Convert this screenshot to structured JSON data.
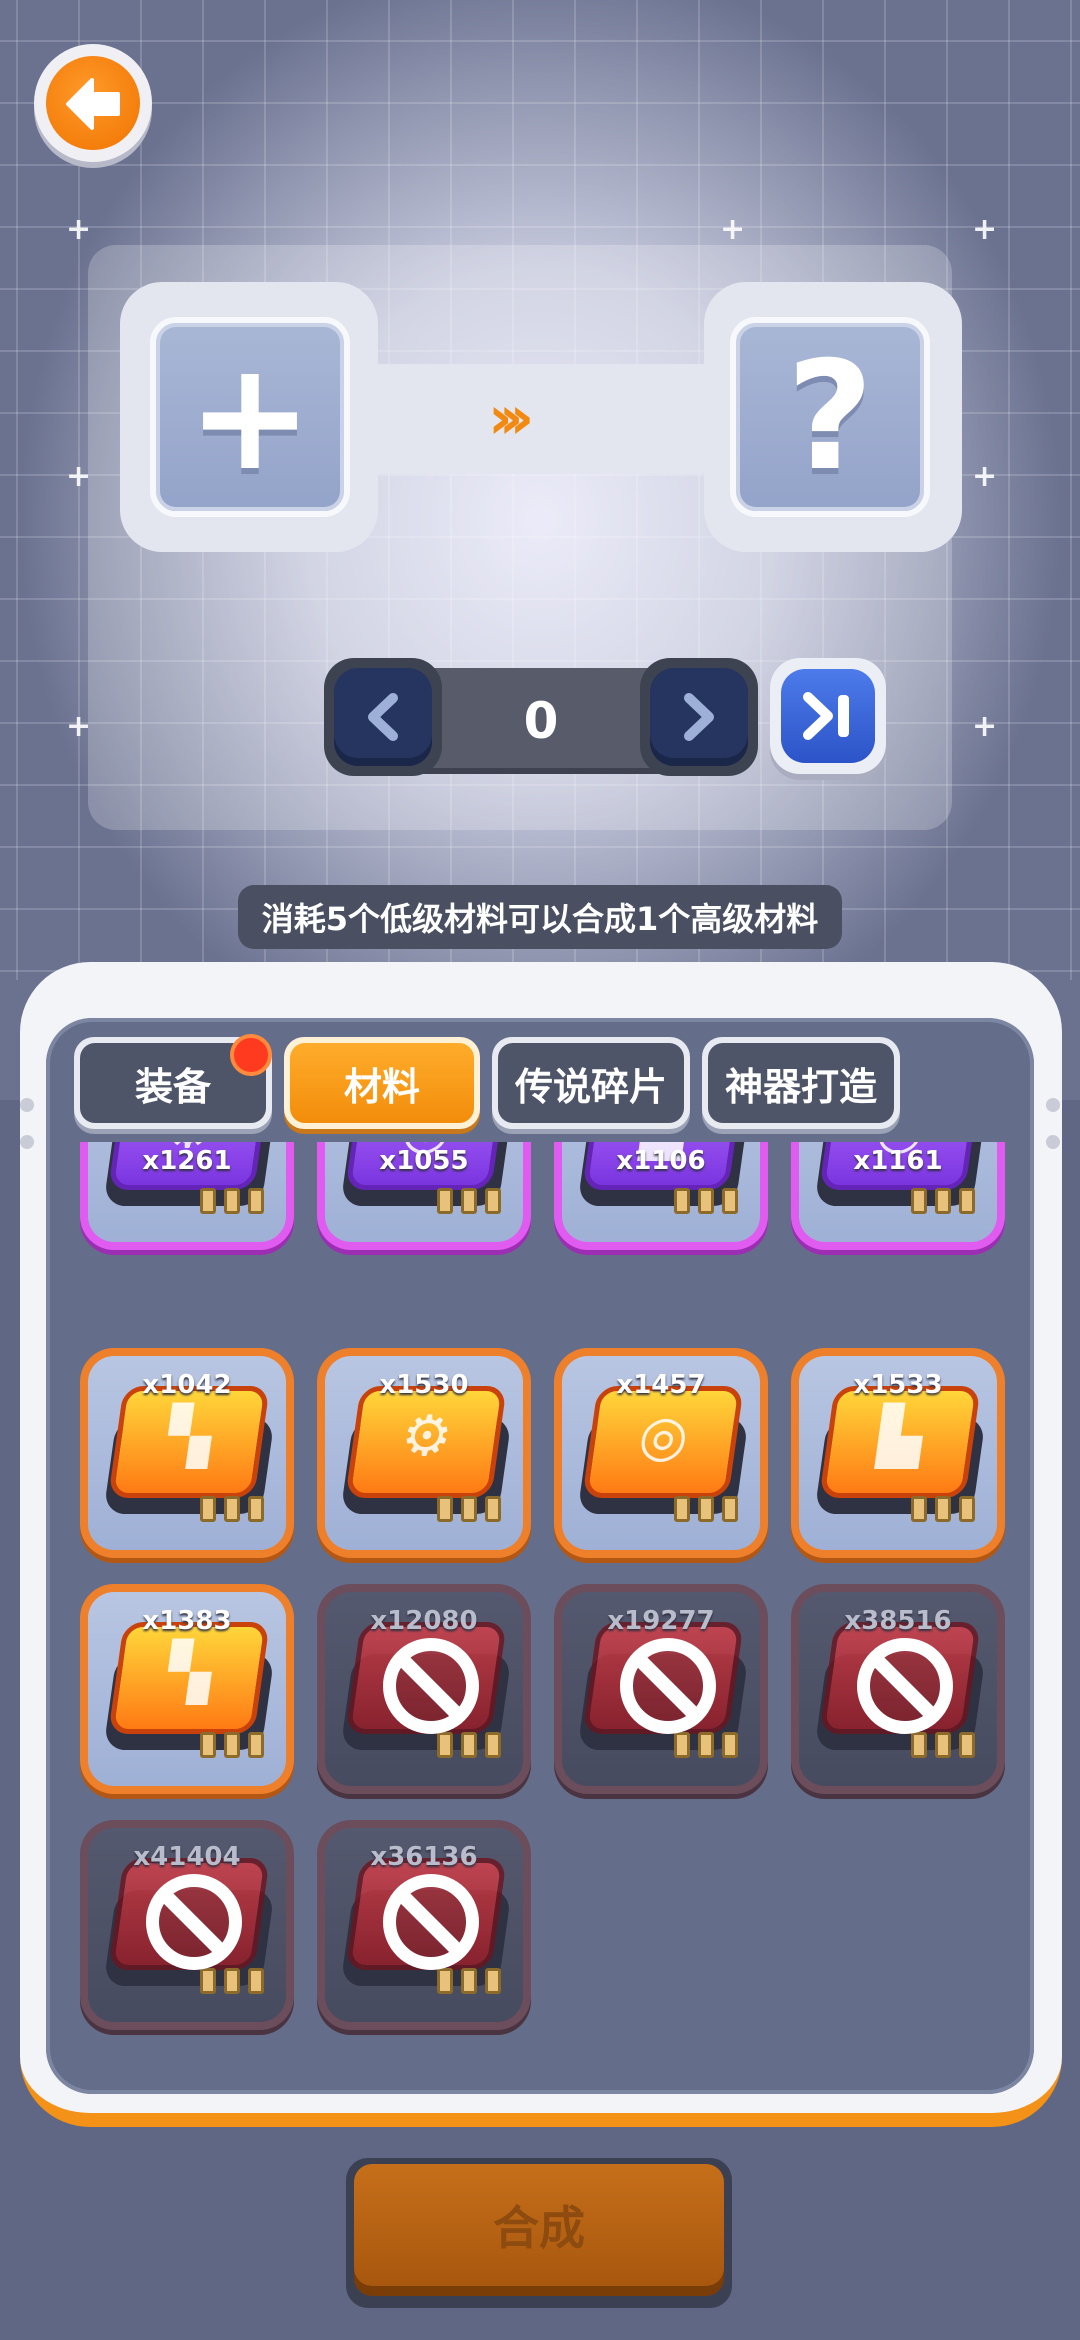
{
  "header": {
    "back_icon": "arrow-left-icon"
  },
  "merge": {
    "input_slot_glyph": "+",
    "output_slot_glyph": "?",
    "arrow_glyph": "›››",
    "count": "0",
    "hint": "消耗5个低级材料可以合成1个高级材料"
  },
  "tabs": [
    {
      "label": "装备",
      "active": false,
      "badge": true
    },
    {
      "label": "材料",
      "active": true,
      "badge": false
    },
    {
      "label": "传说碎片",
      "active": false,
      "badge": false
    },
    {
      "label": "神器打造",
      "active": false,
      "badge": false
    }
  ],
  "items": [
    {
      "qty": "x1261",
      "rarity": "purple",
      "icon": "gear-icon",
      "locked": false
    },
    {
      "qty": "x1055",
      "rarity": "purple",
      "icon": "target-icon",
      "locked": false
    },
    {
      "qty": "x1106",
      "rarity": "purple",
      "icon": "boot-icon",
      "locked": false
    },
    {
      "qty": "x1161",
      "rarity": "purple",
      "icon": "helmet-icon",
      "locked": false
    },
    {
      "qty": "x1042",
      "rarity": "orange",
      "icon": "armor-icon",
      "locked": false
    },
    {
      "qty": "x1530",
      "rarity": "orange",
      "icon": "gear-icon",
      "locked": false
    },
    {
      "qty": "x1457",
      "rarity": "orange",
      "icon": "target-icon",
      "locked": false
    },
    {
      "qty": "x1533",
      "rarity": "orange",
      "icon": "boot-icon",
      "locked": false
    },
    {
      "qty": "x1383",
      "rarity": "orange",
      "icon": "armor-icon",
      "locked": false
    },
    {
      "qty": "x12080",
      "rarity": "locked",
      "icon": "chip-icon",
      "locked": true
    },
    {
      "qty": "x19277",
      "rarity": "locked",
      "icon": "chip-icon",
      "locked": true
    },
    {
      "qty": "x38516",
      "rarity": "locked",
      "icon": "chip-icon",
      "locked": true
    },
    {
      "qty": "x41404",
      "rarity": "locked",
      "icon": "chip-icon",
      "locked": true
    },
    {
      "qty": "x36136",
      "rarity": "locked",
      "icon": "chip-icon",
      "locked": true
    }
  ],
  "footer": {
    "merge_label": "合成"
  },
  "colors": {
    "accent": "#f28d0b",
    "purple": "#e05bf0",
    "orange": "#ee7f2b",
    "locked": "#6b4d5c",
    "badge": "#ff3a1f"
  }
}
